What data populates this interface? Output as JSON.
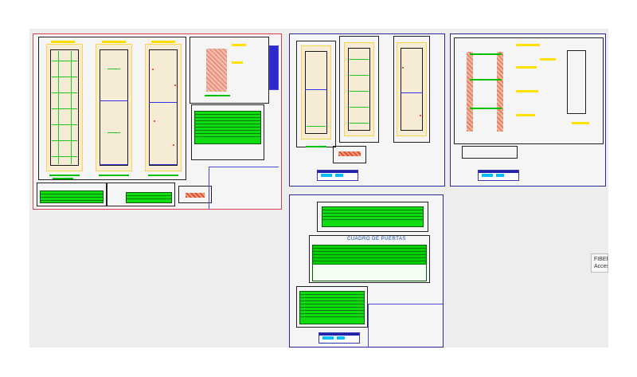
{
  "canvas": {
    "background": "#ededed",
    "sheets": [
      {
        "id": "sheet-door-elevations",
        "selected": true,
        "accent": "#e0404a"
      },
      {
        "id": "sheet-door-details"
      },
      {
        "id": "sheet-wall-section"
      },
      {
        "id": "sheet-door-schedule"
      }
    ]
  },
  "labels": {
    "cuadro_de_puertas": "CUADRO DE PUERTAS"
  },
  "tooltip": {
    "line1": "FIBER",
    "line2": "Acces"
  },
  "colors": {
    "selection_border": "#e0404a",
    "sheet_border": "#2a2a9a",
    "table_fill": "#10dd10",
    "annotation": "#ffe000",
    "dimension": "#22c422"
  }
}
